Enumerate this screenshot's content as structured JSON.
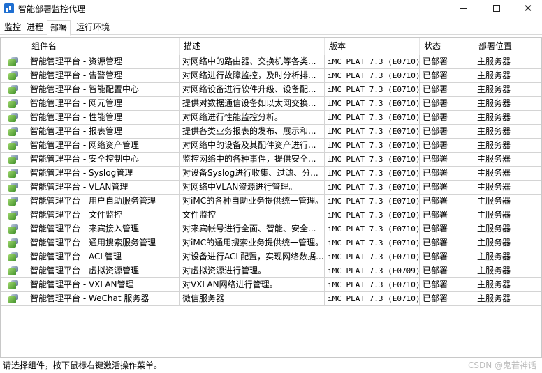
{
  "window": {
    "title": "智能部署监控代理"
  },
  "tabs": [
    {
      "label": "监控"
    },
    {
      "label": "进程"
    },
    {
      "label": "部署"
    },
    {
      "label": "运行环境"
    }
  ],
  "table": {
    "columns": [
      "组件名",
      "描述",
      "版本",
      "状态",
      "部署位置"
    ],
    "rows": [
      {
        "name": "智能管理平台 - 资源管理",
        "desc": "对网络中的路由器、交换机等各类...",
        "version": "iMC PLAT 7.3 (E0710)",
        "state": "已部署",
        "location": "主服务器"
      },
      {
        "name": "智能管理平台 - 告警管理",
        "desc": "对网络进行故障监控，及时分析排...",
        "version": "iMC PLAT 7.3 (E0710)",
        "state": "已部署",
        "location": "主服务器"
      },
      {
        "name": "智能管理平台 - 智能配置中心",
        "desc": "对网络设备进行软件升级、设备配...",
        "version": "iMC PLAT 7.3 (E0710)",
        "state": "已部署",
        "location": "主服务器"
      },
      {
        "name": "智能管理平台 - 网元管理",
        "desc": "提供对数据通信设备如以太网交换...",
        "version": "iMC PLAT 7.3 (E0710)",
        "state": "已部署",
        "location": "主服务器"
      },
      {
        "name": "智能管理平台 - 性能管理",
        "desc": "对网络进行性能监控分析。",
        "version": "iMC PLAT 7.3 (E0710)",
        "state": "已部署",
        "location": "主服务器"
      },
      {
        "name": "智能管理平台 - 报表管理",
        "desc": "提供各类业务报表的发布、展示和...",
        "version": "iMC PLAT 7.3 (E0710)",
        "state": "已部署",
        "location": "主服务器"
      },
      {
        "name": "智能管理平台 - 网络资产管理",
        "desc": "对网络中的设备及其配件资产进行...",
        "version": "iMC PLAT 7.3 (E0710)",
        "state": "已部署",
        "location": "主服务器"
      },
      {
        "name": "智能管理平台 - 安全控制中心",
        "desc": "监控网络中的各种事件，提供安全...",
        "version": "iMC PLAT 7.3 (E0710)",
        "state": "已部署",
        "location": "主服务器"
      },
      {
        "name": "智能管理平台 - Syslog管理",
        "desc": "对设备Syslog进行收集、过滤、分...",
        "version": "iMC PLAT 7.3 (E0710)",
        "state": "已部署",
        "location": "主服务器"
      },
      {
        "name": "智能管理平台 - VLAN管理",
        "desc": "对网络中VLAN资源进行管理。",
        "version": "iMC PLAT 7.3 (E0710)",
        "state": "已部署",
        "location": "主服务器"
      },
      {
        "name": "智能管理平台 - 用户自助服务管理",
        "desc": "对iMC的各种自助业务提供统一管理。",
        "version": "iMC PLAT 7.3 (E0710)",
        "state": "已部署",
        "location": "主服务器"
      },
      {
        "name": "智能管理平台 - 文件监控",
        "desc": "文件监控",
        "version": "iMC PLAT 7.3 (E0710)",
        "state": "已部署",
        "location": "主服务器"
      },
      {
        "name": "智能管理平台 - 来宾接入管理",
        "desc": "对来宾帐号进行全面、智能、安全...",
        "version": "iMC PLAT 7.3 (E0710)",
        "state": "已部署",
        "location": "主服务器"
      },
      {
        "name": "智能管理平台 - 通用搜索服务管理",
        "desc": "对iMC的通用搜索业务提供统一管理。",
        "version": "iMC PLAT 7.3 (E0710)",
        "state": "已部署",
        "location": "主服务器"
      },
      {
        "name": "智能管理平台 - ACL管理",
        "desc": "对设备进行ACL配置，实现网络数据...",
        "version": "iMC PLAT 7.3 (E0710)",
        "state": "已部署",
        "location": "主服务器"
      },
      {
        "name": "智能管理平台 - 虚拟资源管理",
        "desc": "对虚拟资源进行管理。",
        "version": "iMC PLAT 7.3 (E0709)",
        "state": "已部署",
        "location": "主服务器"
      },
      {
        "name": "智能管理平台 - VXLAN管理",
        "desc": "对VXLAN网络进行管理。",
        "version": "iMC PLAT 7.3 (E0710)",
        "state": "已部署",
        "location": "主服务器"
      },
      {
        "name": "智能管理平台 - WeChat 服务器",
        "desc": "微信服务器",
        "version": "iMC PLAT 7.3 (E0710)",
        "state": "已部署",
        "location": "主服务器"
      }
    ]
  },
  "statusbar": {
    "text": "请选择组件，按下鼠标右键激活操作菜单。",
    "watermark": "CSDN @鬼若神话"
  },
  "icons": {
    "app": "app-icon",
    "component": "component-icon"
  },
  "colors": {
    "accent": "#1f6fd1"
  }
}
